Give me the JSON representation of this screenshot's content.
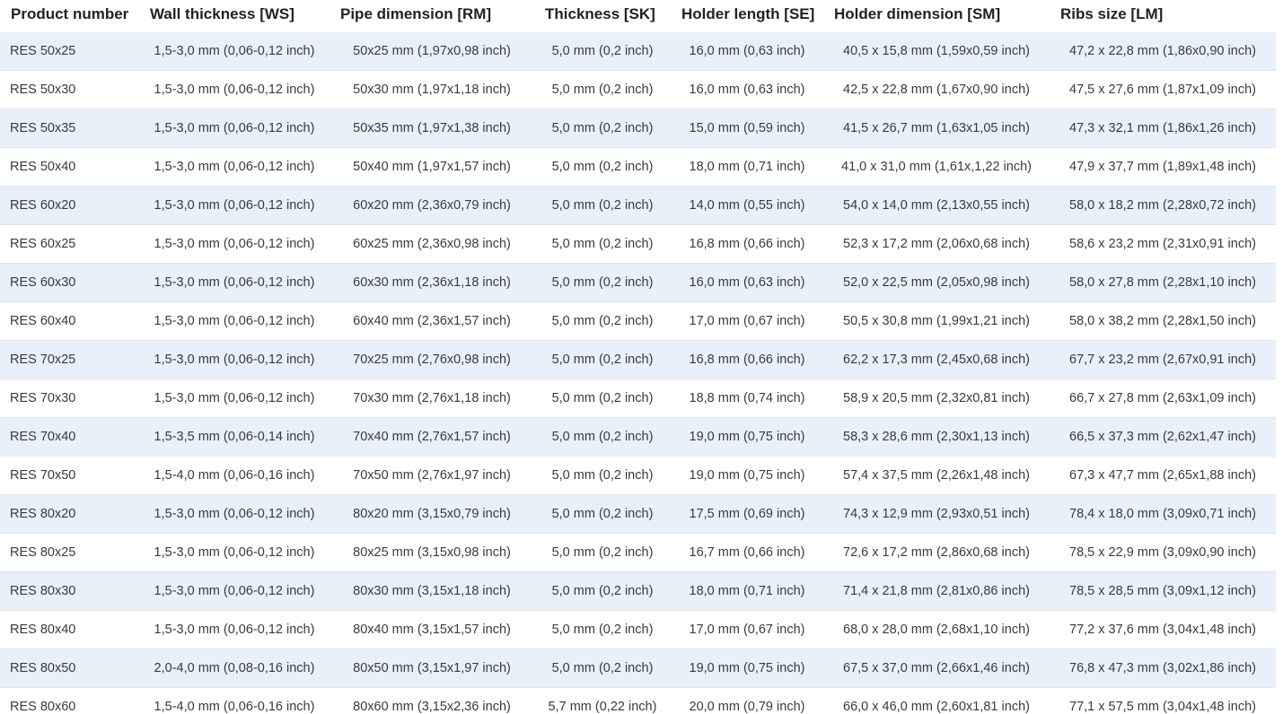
{
  "table": {
    "headers": [
      "Product number",
      "Wall thickness [WS]",
      "Pipe dimension [RM]",
      "Thickness [SK]",
      "Holder length [SE]",
      "Holder dimension [SM]",
      "Ribs size [LM]"
    ],
    "rows": [
      [
        "RES 50x25",
        "1,5-3,0 mm (0,06-0,12 inch)",
        "50x25 mm (1,97x0,98 inch)",
        "5,0 mm (0,2 inch)",
        "16,0 mm (0,63 inch)",
        "40,5 x 15,8 mm (1,59x0,59 inch)",
        "47,2 x 22,8 mm (1,86x0,90 inch)"
      ],
      [
        "RES 50x30",
        "1,5-3,0 mm (0,06-0,12 inch)",
        "50x30 mm (1,97x1,18 inch)",
        "5,0 mm (0,2 inch)",
        "16,0 mm (0,63 inch)",
        "42,5 x 22,8 mm (1,67x0,90 inch)",
        "47,5 x 27,6 mm (1,87x1,09 inch)"
      ],
      [
        "RES 50x35",
        "1,5-3,0 mm (0,06-0,12 inch)",
        "50x35 mm (1,97x1,38 inch)",
        "5,0 mm (0,2 inch)",
        "15,0 mm (0,59 inch)",
        "41,5 x 26,7 mm (1,63x1,05 inch)",
        "47,3 x 32,1 mm (1,86x1,26 inch)"
      ],
      [
        "RES 50x40",
        "1,5-3,0 mm (0,06-0,12 inch)",
        "50x40 mm (1,97x1,57 inch)",
        "5,0 mm (0,2 inch)",
        "18,0  mm (0,71 inch)",
        "41,0 x 31,0 mm (1,61x,1,22 inch)",
        "47,9 x 37,7 mm (1,89x1,48 inch)"
      ],
      [
        "RES 60x20",
        "1,5-3,0 mm (0,06-0,12 inch)",
        "60x20 mm (2,36x0,79 inch)",
        "5,0 mm (0,2 inch)",
        "14,0 mm (0,55 inch)",
        "54,0 x 14,0 mm (2,13x0,55 inch)",
        "58,0 x 18,2 mm (2,28x0,72 inch)"
      ],
      [
        "RES 60x25",
        "1,5-3,0 mm (0,06-0,12 inch)",
        "60x25 mm (2,36x0,98 inch)",
        "5,0 mm (0,2 inch)",
        "16,8 mm (0,66 inch)",
        "52,3 x 17,2 mm (2,06x0,68 inch)",
        "58,6 x 23,2 mm (2,31x0,91 inch)"
      ],
      [
        "RES 60x30",
        "1,5-3,0 mm (0,06-0,12 inch)",
        "60x30 mm (2,36x1,18 inch)",
        "5,0 mm (0,2 inch)",
        "16,0 mm (0,63 inch)",
        "52,0 x 22,5 mm (2,05x0,98 inch)",
        "58,0 x 27,8 mm (2,28x1,10 inch)"
      ],
      [
        "RES 60x40",
        "1,5-3,0 mm (0,06-0,12 inch)",
        "60x40 mm (2,36x1,57 inch)",
        "5,0 mm (0,2 inch)",
        "17,0 mm (0,67 inch)",
        "50,5 x 30,8 mm (1,99x1,21 inch)",
        "58,0 x 38,2 mm (2,28x1,50 inch)"
      ],
      [
        "RES 70x25",
        "1,5-3,0 mm (0,06-0,12 inch)",
        "70x25 mm (2,76x0,98 inch)",
        "5,0 mm (0,2 inch)",
        "16,8 mm (0,66 inch)",
        "62,2 x 17,3 mm (2,45x0,68 inch)",
        "67,7 x 23,2 mm (2,67x0,91 inch)"
      ],
      [
        "RES 70x30",
        "1,5-3,0 mm (0,06-0,12 inch)",
        "70x30 mm (2,76x1,18 inch)",
        "5,0 mm (0,2 inch)",
        "18,8 mm (0,74 inch)",
        "58,9 x 20,5 mm (2,32x0,81 inch)",
        "66,7 x 27,8 mm (2,63x1,09 inch)"
      ],
      [
        "RES 70x40",
        "1,5-3,5 mm (0,06-0,14 inch)",
        "70x40 mm (2,76x1,57 inch)",
        "5,0 mm (0,2 inch)",
        "19,0 mm (0,75 inch)",
        "58,3 x 28,6 mm (2,30x1,13 inch)",
        "66,5 x 37,3 mm (2,62x1,47 inch)"
      ],
      [
        "RES 70x50",
        "1,5-4,0 mm (0,06-0,16 inch)",
        "70x50 mm (2,76x1,97 inch)",
        "5,0 mm (0,2 inch)",
        "19,0 mm (0,75 inch)",
        "57,4 x 37,5 mm (2,26x1,48 inch)",
        "67,3 x 47,7 mm (2,65x1,88 inch)"
      ],
      [
        "RES 80x20",
        "1,5-3,0 mm (0,06-0,12 inch)",
        "80x20 mm (3,15x0,79 inch)",
        "5,0 mm (0,2 inch)",
        "17,5 mm (0,69 inch)",
        "74,3 x 12,9 mm (2,93x0,51 inch)",
        "78,4 x 18,0 mm (3,09x0,71 inch)"
      ],
      [
        "RES 80x25",
        "1,5-3,0 mm (0,06-0,12 inch)",
        "80x25 mm (3,15x0,98 inch)",
        "5,0 mm (0,2 inch)",
        "16,7 mm (0,66 inch)",
        "72,6 x 17,2 mm (2,86x0,68 inch)",
        "78,5 x 22,9 mm (3,09x0,90 inch)"
      ],
      [
        "RES 80x30",
        "1,5-3,0 mm (0,06-0,12 inch)",
        "80x30 mm (3,15x1,18 inch)",
        "5,0 mm (0,2 inch)",
        "18,0 mm (0,71 inch)",
        "71,4 x 21,8 mm (2,81x0,86 inch)",
        "78,5 x 28,5 mm (3,09x1,12 inch)"
      ],
      [
        "RES 80x40",
        "1,5-3,0 mm (0,06-0,12 inch)",
        "80x40 mm (3,15x1,57 inch)",
        "5,0 mm (0,2 inch)",
        "17,0 mm (0,67 inch)",
        "68,0 x 28,0 mm (2,68x1,10 inch)",
        "77,2 x 37,6 mm (3,04x1,48 inch)"
      ],
      [
        "RES 80x50",
        "2,0-4,0 mm (0,08-0,16 inch)",
        "80x50 mm (3,15x1,97 inch)",
        "5,0 mm (0,2 inch)",
        "19,0 mm (0,75 inch)",
        "67,5 x 37,0 mm (2,66x1,46 inch)",
        "76,8 x 47,3 mm (3,02x1,86 inch)"
      ],
      [
        "RES 80x60",
        "1,5-4,0 mm (0,06-0,16 inch)",
        "80x60 mm (3,15x2,36 inch)",
        "5,7 mm (0,22 inch)",
        "20,0 mm (0,79 inch)",
        "66,0 x 46,0 mm (2,60x1,81 inch)",
        "77,1 x 57,5 mm (3,04x1,48 inch)"
      ]
    ]
  },
  "colors": {
    "row_alt_background": "#e8f0fa",
    "row_border": "#dfe5ee",
    "header_text": "#222222",
    "cell_text": "#3a3a3a"
  }
}
